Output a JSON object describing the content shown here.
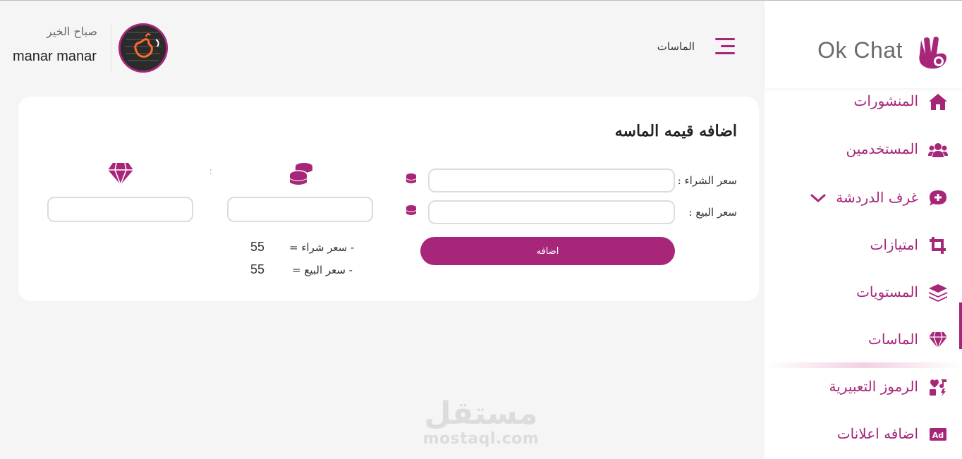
{
  "brand": {
    "name": "Ok Chat"
  },
  "colors": {
    "accent": "#a7267a",
    "background": "#f5f5f5",
    "card": "#ffffff"
  },
  "header": {
    "greeting": "صباح الخير",
    "username": "manar manar",
    "breadcrumb": "الماسات",
    "menu_icon": "hamburger-icon"
  },
  "sidebar": {
    "items": [
      {
        "label": "المنشورات",
        "icon": "home-icon"
      },
      {
        "label": "المستخدمين",
        "icon": "users-icon"
      },
      {
        "label": "غرف الدردشة",
        "icon": "chat-plus-icon",
        "expandable": true
      },
      {
        "label": "امتيازات",
        "icon": "crop-icon"
      },
      {
        "label": "المستويات",
        "icon": "layers-icon"
      },
      {
        "label": "الماسات",
        "icon": "diamond-icon",
        "active": true
      },
      {
        "label": "الرموز التعبيرية",
        "icon": "icons-icon"
      },
      {
        "label": "اضافه اعلانات",
        "icon": "ad-icon"
      }
    ]
  },
  "form": {
    "title": "اضافه قيمه الماسه",
    "buy_label": "سعر الشراء :",
    "sell_label": "سعر البيع :",
    "buy_value": "",
    "sell_value": "",
    "submit_label": "اضافه",
    "coins_value": "",
    "diamonds_value": "",
    "colon": ":"
  },
  "summary": {
    "buy_label": "- سعر شراء =",
    "buy_value": "55",
    "sell_label": "- سعر البيع =",
    "sell_value": "55"
  },
  "watermark": {
    "arabic": "مستقل",
    "latin": "mostaql.com"
  }
}
